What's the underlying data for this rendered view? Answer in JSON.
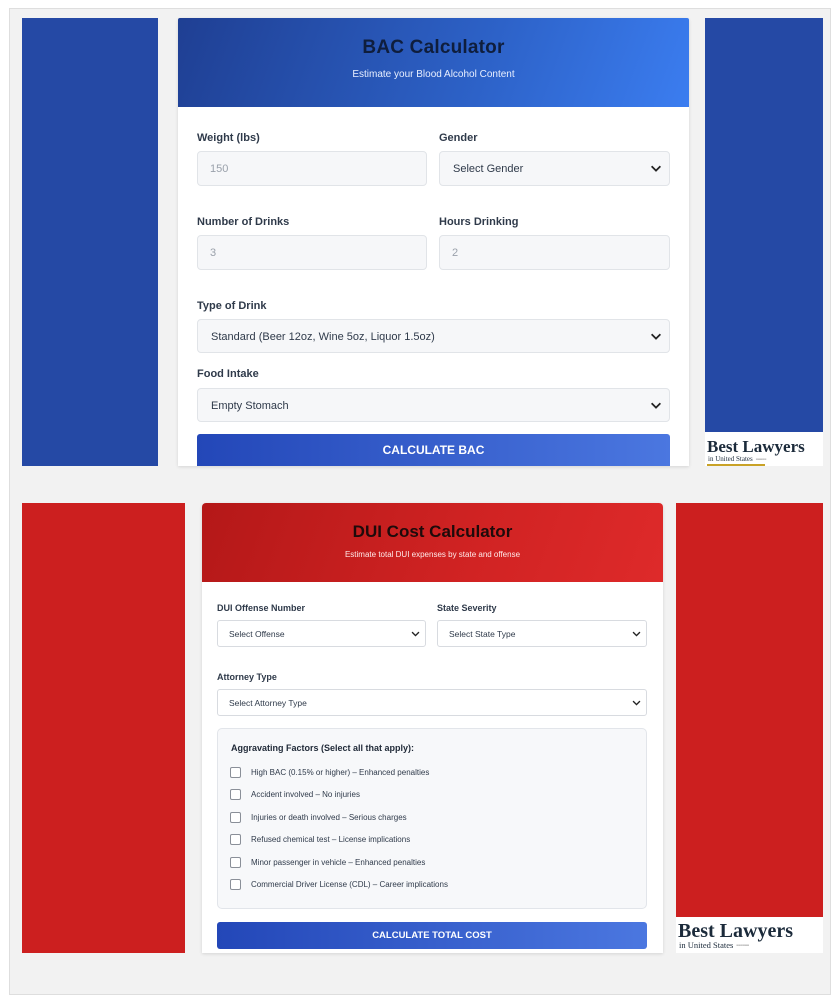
{
  "bac": {
    "title": "BAC Calculator",
    "subtitle": "Estimate your Blood Alcohol Content",
    "weight_label": "Weight (lbs)",
    "weight_placeholder": "150",
    "gender_label": "Gender",
    "gender_value": "Select Gender",
    "drinks_label": "Number of Drinks",
    "drinks_placeholder": "3",
    "hours_label": "Hours Drinking",
    "hours_placeholder": "2",
    "drink_type_label": "Type of Drink",
    "drink_type_value": "Standard (Beer 12oz, Wine 5oz, Liquor 1.5oz)",
    "food_label": "Food Intake",
    "food_value": "Empty Stomach",
    "button_label": "CALCULATE BAC"
  },
  "dui": {
    "title": "DUI Cost Calculator",
    "subtitle": "Estimate total DUI expenses by state and offense",
    "offense_label": "DUI Offense Number",
    "offense_value": "Select Offense",
    "state_label": "State Severity",
    "state_value": "Select State Type",
    "attorney_label": "Attorney Type",
    "attorney_value": "Select Attorney Type",
    "aggravating_title": "Aggravating Factors (Select all that apply):",
    "factors": [
      "High BAC (0.15% or higher) – Enhanced penalties",
      "Accident involved – No injuries",
      "Injuries or death involved – Serious charges",
      "Refused chemical test – License implications",
      "Minor passenger in vehicle – Enhanced penalties",
      "Commercial Driver License (CDL) – Career implications"
    ],
    "button_label": "CALCULATE TOTAL COST"
  },
  "logo": {
    "line1": "Best Lawyers",
    "line2": "in United States"
  },
  "colors": {
    "bac_blue": "#2549a5",
    "dui_red": "#cc1f1f",
    "button_blue": "#2347b8"
  }
}
